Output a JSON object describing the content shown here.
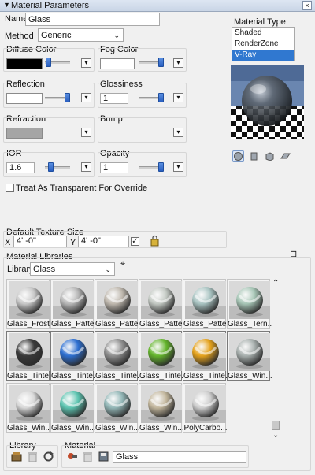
{
  "header": {
    "title": "Material Parameters",
    "close_glyph": "×",
    "collapse_glyph": "▼"
  },
  "name": {
    "label": "Name",
    "value": "Glass"
  },
  "method": {
    "label": "Method",
    "value": "Generic"
  },
  "diffuse": {
    "label": "Diffuse Color",
    "color": "#000000"
  },
  "fog": {
    "label": "Fog Color",
    "color": "#ffffff"
  },
  "reflection": {
    "label": "Reflection",
    "color": "#ffffff"
  },
  "glossiness": {
    "label": "Glossiness",
    "value": "1"
  },
  "refraction": {
    "label": "Refraction",
    "color": "#a5a5a5"
  },
  "bump": {
    "label": "Bump"
  },
  "ior": {
    "label": "IOR",
    "value": "1.6"
  },
  "opacity": {
    "label": "Opacity",
    "value": "1"
  },
  "treat_transparent": {
    "label": "Treat As Transparent For Override",
    "checked": false
  },
  "material_type": {
    "label": "Material Type",
    "options": [
      "Shaded",
      "RenderZone",
      "V-Ray"
    ],
    "selected_index": 2
  },
  "preview_icons": [
    "sphere-preview-icon",
    "cylinder-preview-icon",
    "cube-preview-icon",
    "plane-preview-icon"
  ],
  "texture_size": {
    "label": "Default Texture Size",
    "x_label": "X",
    "x_value": "4' -0\"",
    "y_label": "Y",
    "y_value": "4' -0\"",
    "locked": true
  },
  "libraries": {
    "label": "Material Libraries",
    "library_label": "Library:",
    "library_value": "Glass",
    "collapse_glyph": "⊟",
    "items": [
      {
        "label": "Glass_Frost...",
        "tint": "#c9c9c9",
        "selected": false
      },
      {
        "label": "Glass_Patte...",
        "tint": "#b8b8b8",
        "selected": false
      },
      {
        "label": "Glass_Patte...",
        "tint": "#bfb8ae",
        "selected": false
      },
      {
        "label": "Glass_Patte...",
        "tint": "#c3c9c3",
        "selected": false
      },
      {
        "label": "Glass_Patte...",
        "tint": "#a9c4c2",
        "selected": false
      },
      {
        "label": "Glass_Tern...",
        "tint": "#a7c6b6",
        "selected": false
      },
      {
        "label": "Glass_Tinte...",
        "tint": "#3a3a3a",
        "selected": true
      },
      {
        "label": "Glass_Tinte...",
        "tint": "#2d6fd1",
        "selected": true
      },
      {
        "label": "Glass_Tinte...",
        "tint": "#8f8f8f",
        "selected": true
      },
      {
        "label": "Glass_Tinte...",
        "tint": "#64b52c",
        "selected": true
      },
      {
        "label": "Glass_Tinte...",
        "tint": "#e5a21c",
        "selected": true
      },
      {
        "label": "Glass_Win...",
        "tint": "#a8b0ae",
        "selected": true
      },
      {
        "label": "Glass_Win...",
        "tint": "#d9d9d9",
        "selected": false
      },
      {
        "label": "Glass_Win...",
        "tint": "#5cc4b0",
        "selected": false
      },
      {
        "label": "Glass_Win...",
        "tint": "#93b7b7",
        "selected": false
      },
      {
        "label": "Glass_Win...",
        "tint": "#c2b69c",
        "selected": false
      },
      {
        "label": "PolyCarbo...",
        "tint": "#cfcfcf",
        "selected": false
      }
    ]
  },
  "footer": {
    "library_label": "Library",
    "material_label": "Material",
    "material_name": "Glass"
  }
}
